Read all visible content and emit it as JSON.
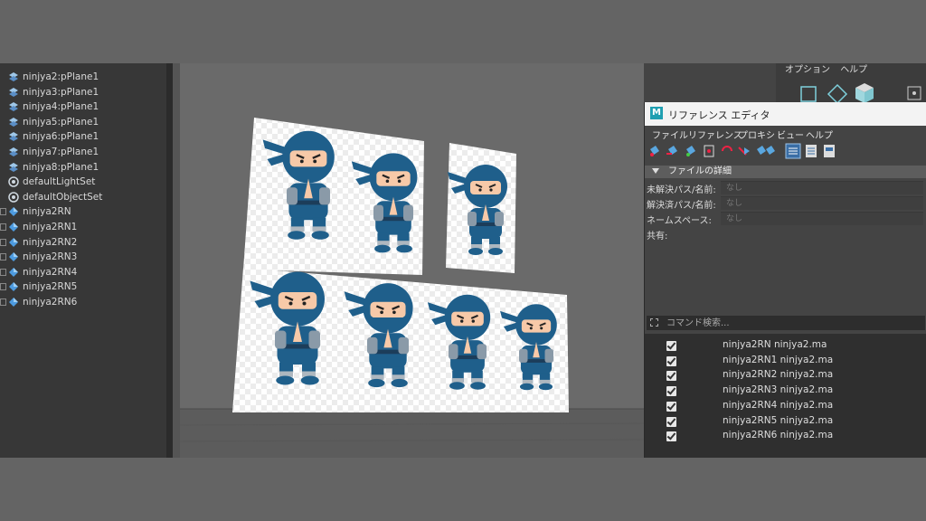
{
  "outliner": {
    "items": [
      {
        "label": "ninjya2:pPlane1",
        "icon": "plane-icon",
        "expandable": false
      },
      {
        "label": "ninjya3:pPlane1",
        "icon": "plane-icon",
        "expandable": false
      },
      {
        "label": "ninjya4:pPlane1",
        "icon": "plane-icon",
        "expandable": false
      },
      {
        "label": "ninjya5:pPlane1",
        "icon": "plane-icon",
        "expandable": false
      },
      {
        "label": "ninjya6:pPlane1",
        "icon": "plane-icon",
        "expandable": false
      },
      {
        "label": "ninjya7:pPlane1",
        "icon": "plane-icon",
        "expandable": false
      },
      {
        "label": "ninjya8:pPlane1",
        "icon": "plane-icon",
        "expandable": false
      },
      {
        "label": "defaultLightSet",
        "icon": "set-icon",
        "expandable": false
      },
      {
        "label": "defaultObjectSet",
        "icon": "set-icon",
        "expandable": false
      },
      {
        "label": "ninjya2RN",
        "icon": "reference-node-icon",
        "expandable": true
      },
      {
        "label": "ninjya2RN1",
        "icon": "reference-node-icon",
        "expandable": true
      },
      {
        "label": "ninjya2RN2",
        "icon": "reference-node-icon",
        "expandable": true
      },
      {
        "label": "ninjya2RN3",
        "icon": "reference-node-icon",
        "expandable": true
      },
      {
        "label": "ninjya2RN4",
        "icon": "reference-node-icon",
        "expandable": true
      },
      {
        "label": "ninjya2RN5",
        "icon": "reference-node-icon",
        "expandable": true
      },
      {
        "label": "ninjya2RN6",
        "icon": "reference-node-icon",
        "expandable": true
      }
    ]
  },
  "tool_menu": {
    "items": [
      "オプション",
      "ヘルプ"
    ]
  },
  "reference_editor": {
    "title": "リファレンス エディタ",
    "logo": "M",
    "menu": [
      "ファイル",
      "リファレンス",
      "プロキシ",
      "ビュー",
      "ヘルプ"
    ],
    "section_title": "ファイルの詳細",
    "fields": [
      {
        "label": "未解決パス/名前:",
        "value": "なし"
      },
      {
        "label": "解決済パス/名前:",
        "value": "なし"
      },
      {
        "label": "ネームスペース:",
        "value": "なし"
      },
      {
        "label": "共有:",
        "value": ""
      }
    ],
    "search_placeholder": "コマンド検索...",
    "references": [
      {
        "node": "ninjya2RN",
        "file": "ninjya2.ma",
        "checked": true
      },
      {
        "node": "ninjya2RN1",
        "file": "ninjya2.ma",
        "checked": true
      },
      {
        "node": "ninjya2RN2",
        "file": "ninjya2.ma",
        "checked": true
      },
      {
        "node": "ninjya2RN3",
        "file": "ninjya2.ma",
        "checked": true
      },
      {
        "node": "ninjya2RN4",
        "file": "ninjya2.ma",
        "checked": true
      },
      {
        "node": "ninjya2RN5",
        "file": "ninjya2.ma",
        "checked": true
      },
      {
        "node": "ninjya2RN6",
        "file": "ninjya2.ma",
        "checked": true
      }
    ]
  },
  "colors": {
    "ninja_blue": "#1f5f8b",
    "skin": "#f7c9a8",
    "maya_teal": "#1f9fb1"
  }
}
